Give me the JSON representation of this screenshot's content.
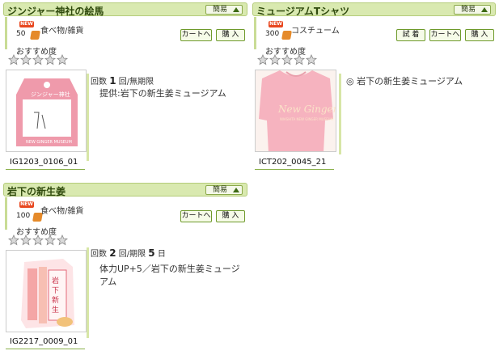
{
  "common": {
    "simple_label": "簡易",
    "new_badge": "NEW",
    "recommend_label": "おすすめ度",
    "cart_label": "カートへ",
    "buy_label": "購 入",
    "try_label": "試 着"
  },
  "items": [
    {
      "title": "ジンジャー神社の絵馬",
      "price": "50",
      "category": "食べ物/雑貨",
      "stars": 0,
      "uses_prefix": "回数",
      "uses_count": "1",
      "uses_suffix": "回/無期限",
      "description": "提供:岩下の新生姜ミュージアム",
      "code": "IG1203_0106_01"
    },
    {
      "title": "ミュージアムTシャツ",
      "price": "300",
      "category": "コスチューム",
      "stars": 0,
      "description": "◎ 岩下の新生姜ミュージアム",
      "code": "ICT202_0045_21"
    },
    {
      "title": "岩下の新生姜",
      "price": "100",
      "category": "食べ物/雑貨",
      "stars": 0,
      "uses_prefix": "回数",
      "uses_count": "2",
      "uses_mid": "回/期限",
      "uses_days": "5",
      "uses_suffix": "日",
      "description_line1": "体力UP+5／岩下の新生姜ミュージ",
      "description_line2": "アム",
      "code": "IG2217_0009_01"
    }
  ]
}
